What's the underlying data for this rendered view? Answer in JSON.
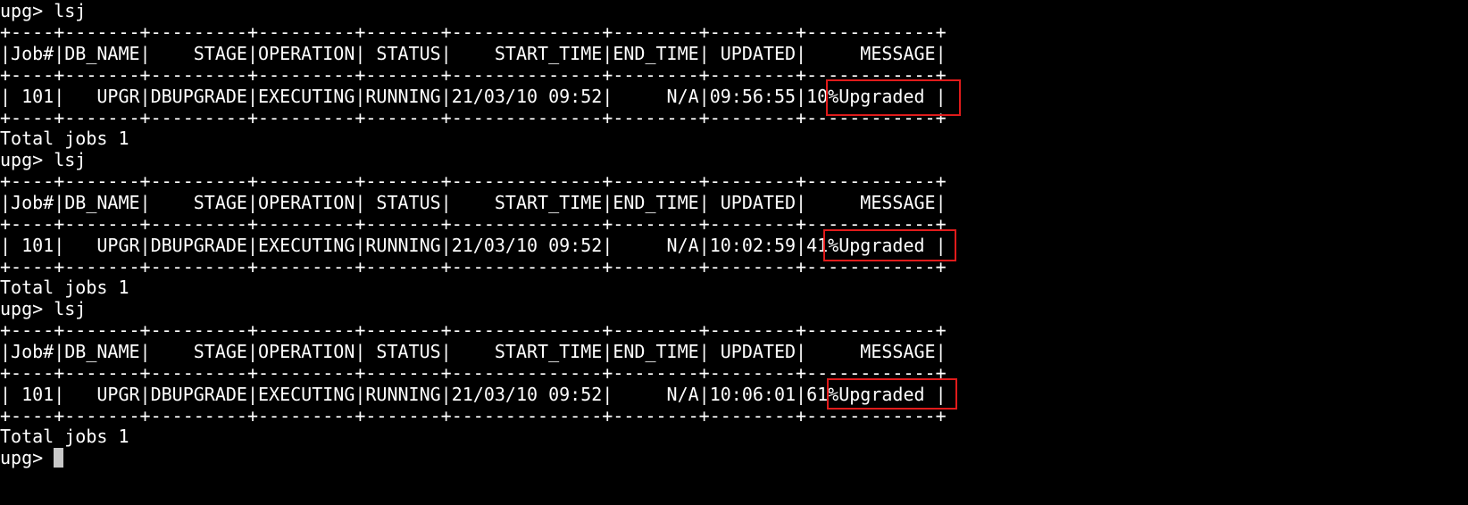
{
  "terminal": {
    "background": "#000000",
    "foreground": "#ffffff",
    "highlight_color": "#e01b1b",
    "prompt": "upg>",
    "blocks": [
      {
        "command": "upg> lsj",
        "separator": "+----+-------+---------+---------+-------+--------------+--------+--------+------------+",
        "header": "|Job#|DB_NAME|    STAGE|OPERATION| STATUS|    START_TIME|END_TIME| UPDATED|     MESSAGE|",
        "row": "| 101|   UPGR|DBUPGRADE|EXECUTING|RUNNING|21/03/10 09:52|     N/A|09:56:55|10%Upgraded |",
        "message": "10%Upgraded",
        "footer": "Total jobs 1"
      },
      {
        "command": "upg> lsj",
        "separator": "+----+-------+---------+---------+-------+--------------+--------+--------+------------+",
        "header": "|Job#|DB_NAME|    STAGE|OPERATION| STATUS|    START_TIME|END_TIME| UPDATED|     MESSAGE|",
        "row": "| 101|   UPGR|DBUPGRADE|EXECUTING|RUNNING|21/03/10 09:52|     N/A|10:02:59|41%Upgraded |",
        "message": "41%Upgraded",
        "footer": "Total jobs 1"
      },
      {
        "command": "upg> lsj",
        "separator": "+----+-------+---------+---------+-------+--------------+--------+--------+------------+",
        "header": "|Job#|DB_NAME|    STAGE|OPERATION| STATUS|    START_TIME|END_TIME| UPDATED|     MESSAGE|",
        "row": "| 101|   UPGR|DBUPGRADE|EXECUTING|RUNNING|21/03/10 09:52|     N/A|10:06:01|61%Upgraded |",
        "message": "61%Upgraded",
        "footer": "Total jobs 1"
      }
    ],
    "final_prompt": "upg> "
  }
}
